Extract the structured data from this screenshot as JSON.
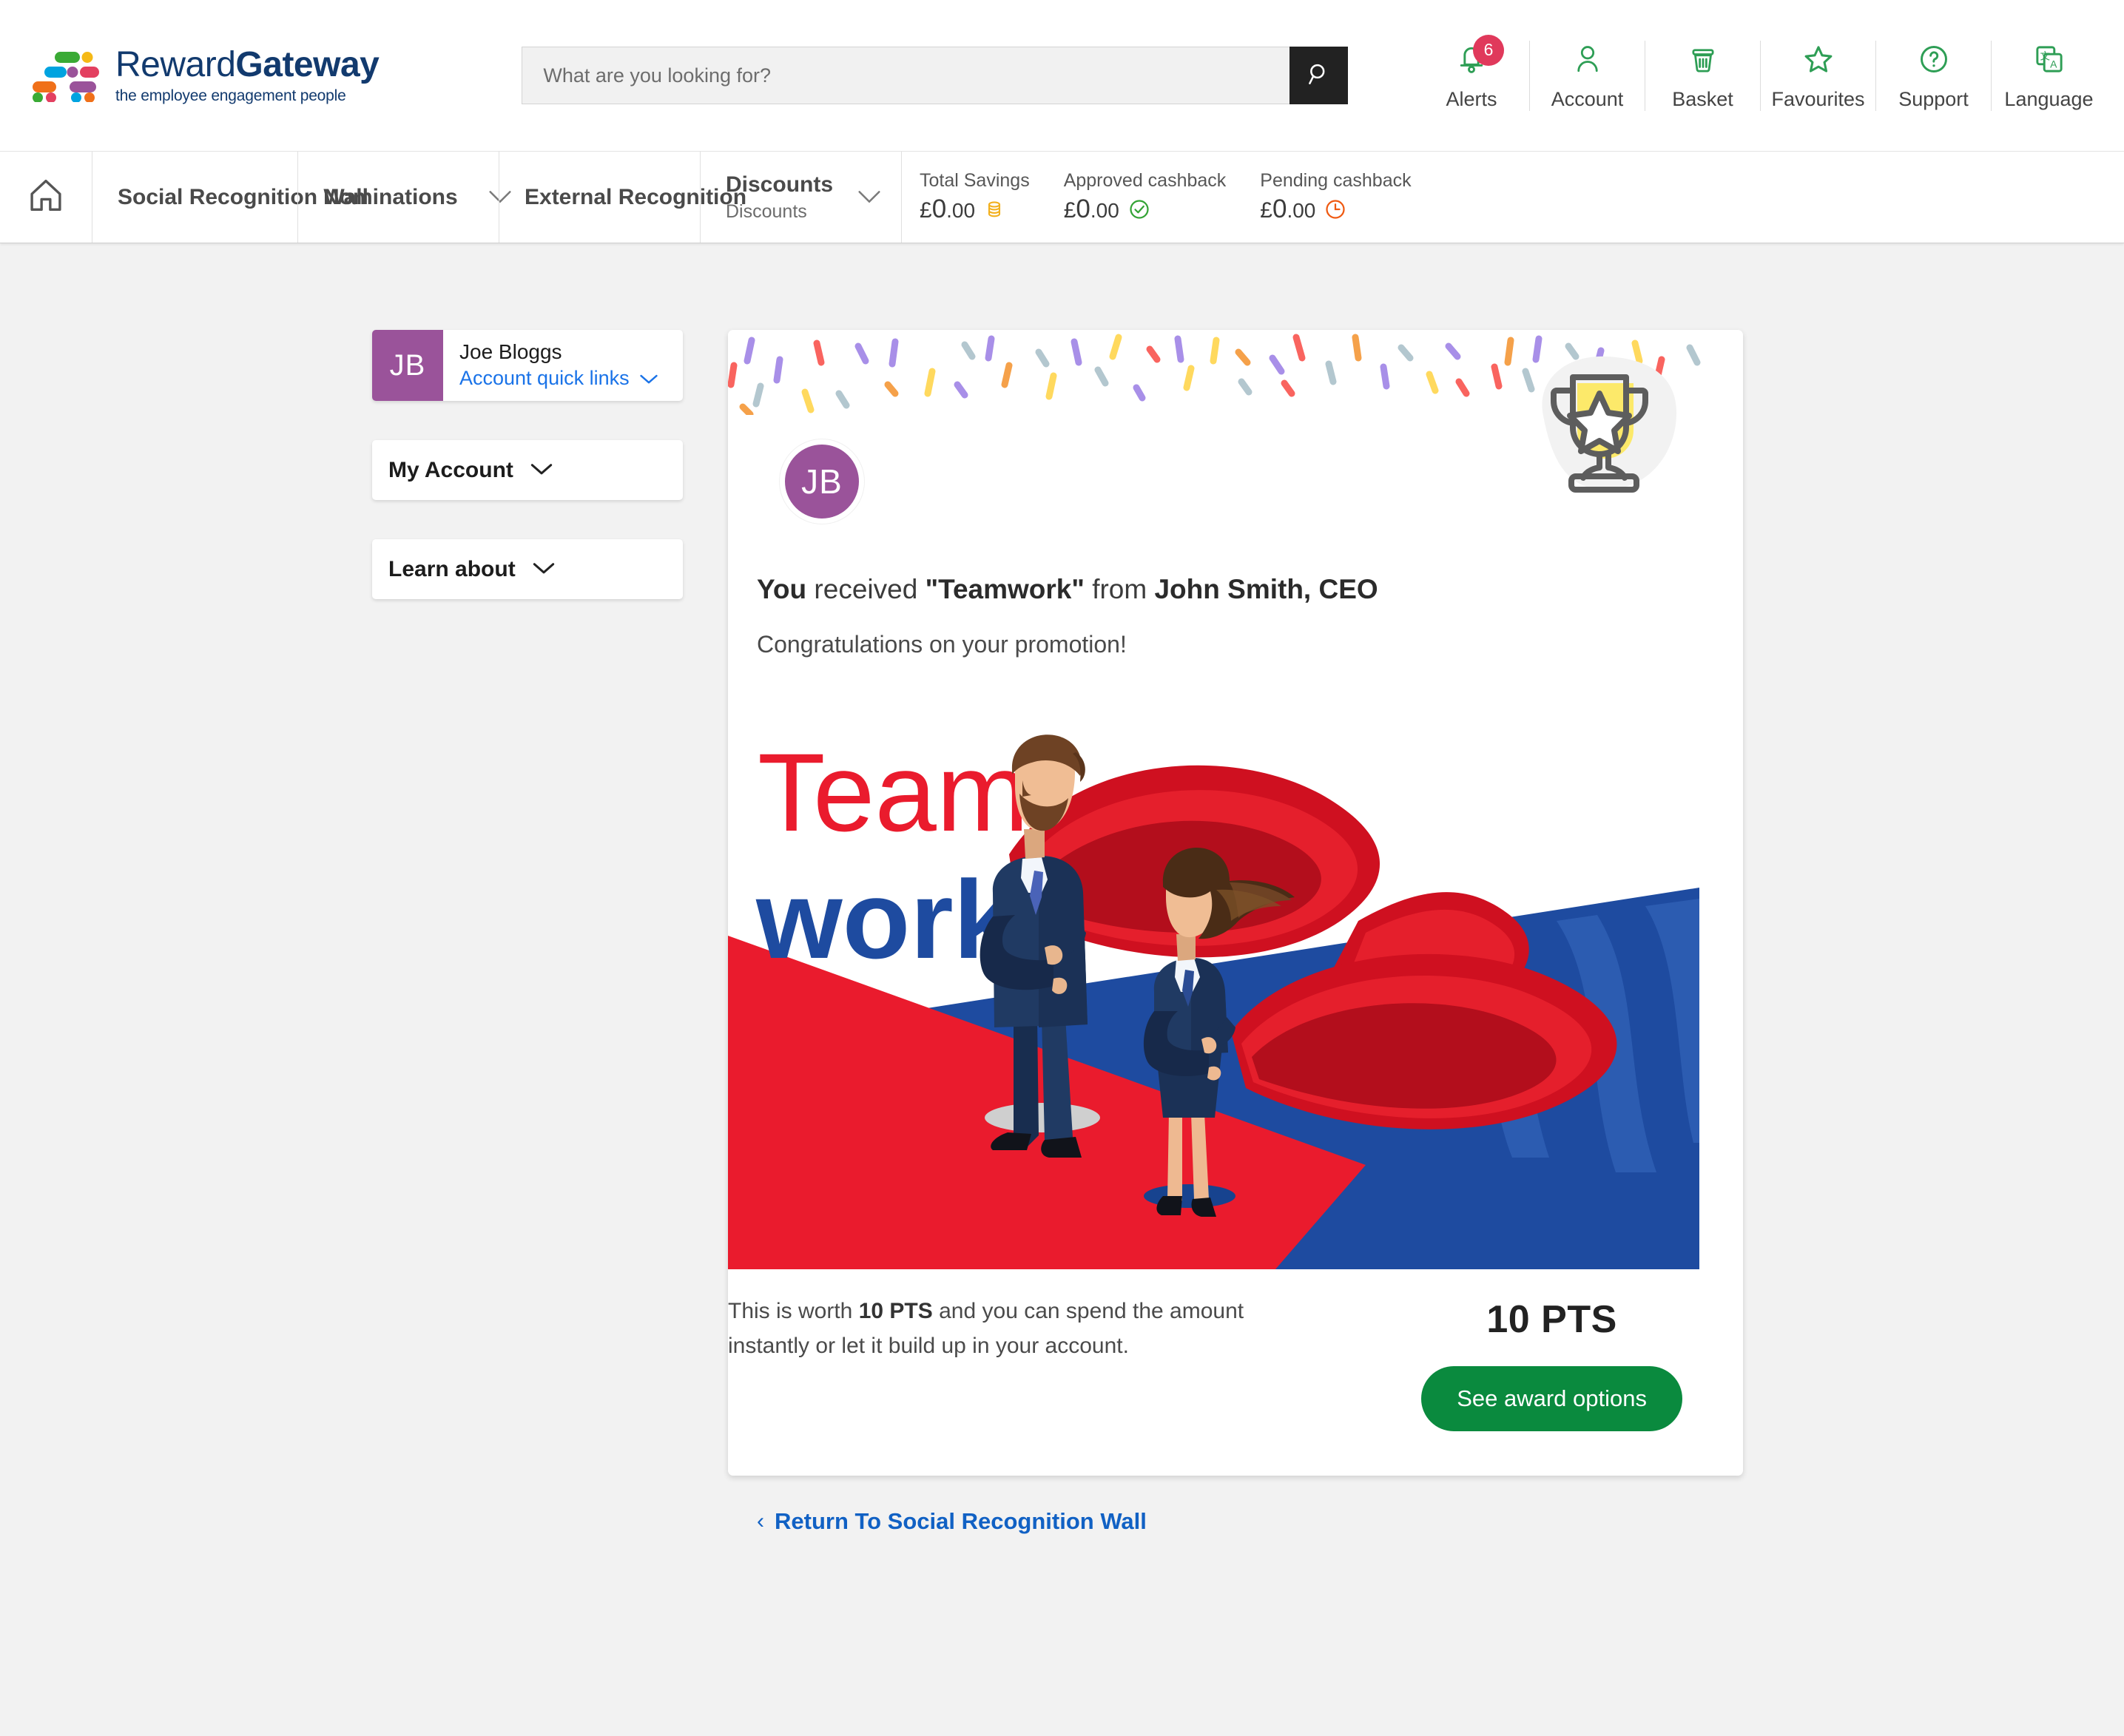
{
  "brand": {
    "name_light": "Reward",
    "name_bold": "Gateway",
    "tagline": "the employee engagement people",
    "logo_icon": "reward-gateway-blocks-logo",
    "navy": "#123a6e"
  },
  "search": {
    "placeholder": "What are you looking for?",
    "value": "",
    "button_icon": "search-icon"
  },
  "util_nav": [
    {
      "label": "Alerts",
      "icon": "bell-icon",
      "badge": "6"
    },
    {
      "label": "Account",
      "icon": "person-icon",
      "badge": ""
    },
    {
      "label": "Basket",
      "icon": "basket-icon",
      "badge": ""
    },
    {
      "label": "Favourites",
      "icon": "star-icon",
      "badge": ""
    },
    {
      "label": "Support",
      "icon": "question-circle-icon",
      "badge": ""
    },
    {
      "label": "Language",
      "icon": "translate-icon",
      "badge": ""
    }
  ],
  "util_icon_color": "#2e9e55",
  "badge_color": "#e0395b",
  "main_nav": {
    "home_icon": "home-icon",
    "items": [
      {
        "label": "Social Recognition Wall",
        "has_chevron": false
      },
      {
        "label": "Nominations",
        "has_chevron": true
      },
      {
        "label": "External Recognition",
        "has_chevron": false
      }
    ],
    "discounts": {
      "title": "Discounts",
      "subtitle": "Discounts",
      "chevron_icon": "chevron-down-icon"
    },
    "savings": [
      {
        "label": "Total Savings",
        "currency": "£",
        "whole": "0",
        "decimal": ".00",
        "icon": "coins-icon",
        "icon_color": "#f2b01e"
      },
      {
        "label": "Approved cashback",
        "currency": "£",
        "whole": "0",
        "decimal": ".00",
        "icon": "check-circle-icon",
        "icon_color": "#34a336"
      },
      {
        "label": "Pending cashback",
        "currency": "£",
        "whole": "0",
        "decimal": ".00",
        "icon": "clock-icon",
        "icon_color": "#ef5a12"
      }
    ]
  },
  "sidebar": {
    "user": {
      "initials": "JB",
      "name": "Joe Bloggs",
      "quick_links_label": "Account quick links",
      "chevron_icon": "chevron-down-icon",
      "avatar_color": "#9a539a"
    },
    "panels": [
      {
        "label": "My Account",
        "chevron_icon": "chevron-down-icon"
      },
      {
        "label": "Learn about",
        "chevron_icon": "chevron-down-icon"
      }
    ]
  },
  "recognition": {
    "avatar_initials": "JB",
    "trophy_icon": "trophy-star-icon",
    "title_you": "You",
    "title_received": " received ",
    "title_award": "\"Teamwork\"",
    "title_from": " from ",
    "title_sender": "John Smith, CEO",
    "message": "Congratulations on your promotion!",
    "hero": {
      "word_top": "Team",
      "word_bottom": "work",
      "word_top_color": "#ea1b2d",
      "word_bottom_color": "#1e4ba0",
      "alt": "two business people in suits wearing red superhero capes"
    },
    "worth_prefix": "This is worth ",
    "worth_points": "10 PTS",
    "worth_suffix": " and you can spend the amount instantly or let it build up in your account.",
    "points_badge": "10 PTS",
    "award_button": "See award options",
    "award_button_color": "#0a8a3e"
  },
  "return_link": {
    "arrow": "‹",
    "label": "Return To Social Recognition Wall"
  }
}
